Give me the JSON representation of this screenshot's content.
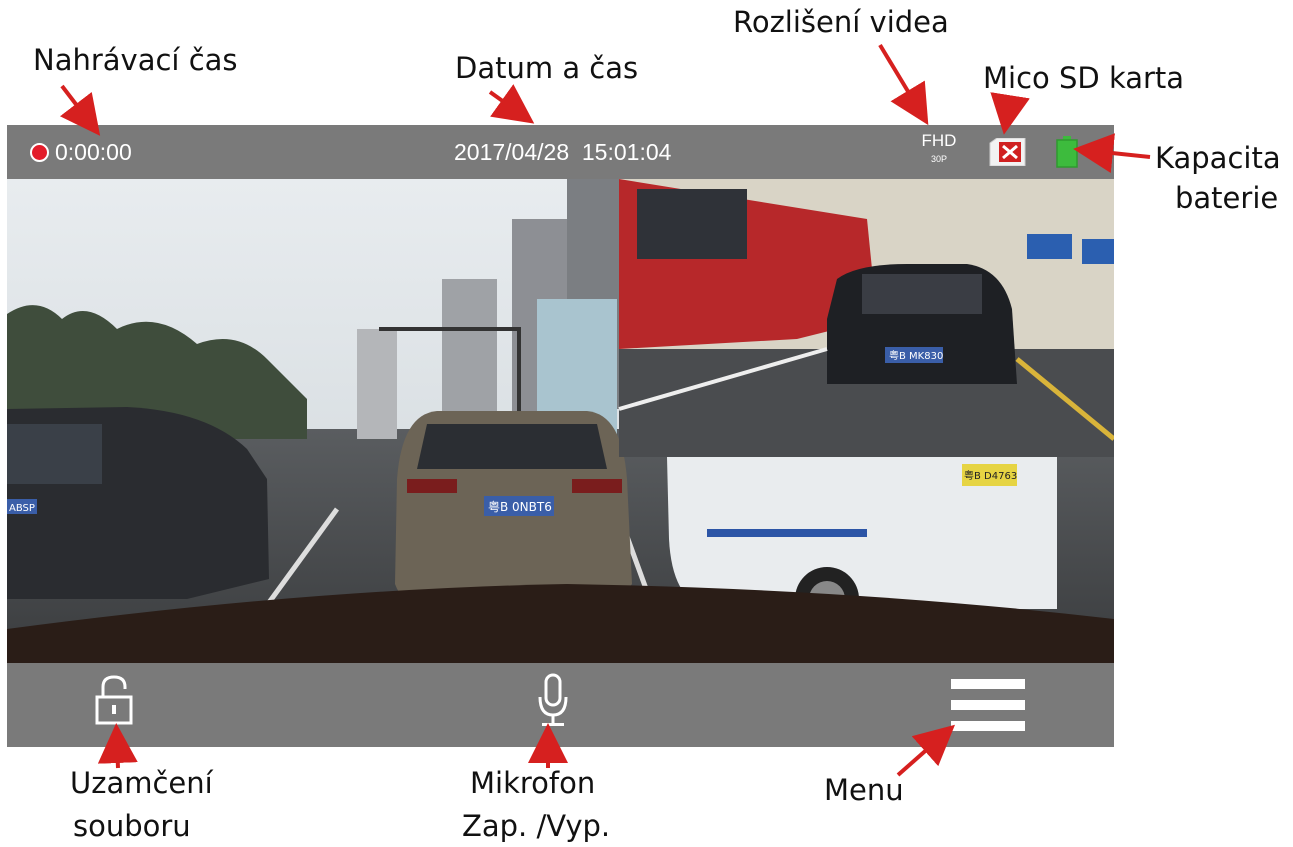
{
  "annotations": {
    "recording_time": "Nahrávací čas",
    "date_time": "Datum a čas",
    "video_resolution": "Rozlišení videa",
    "sd_card": "Mico SD karta",
    "battery_line1": "Kapacita",
    "battery_line2": "baterie",
    "lock_line1": "Uzamčení",
    "lock_line2": "souboru",
    "mic_line1": "Mikrofon",
    "mic_line2": "Zap. /Vyp.",
    "menu": "Menu"
  },
  "status_bar": {
    "recording_time": "0:00:00",
    "date_time": "2017/04/28  15:01:04",
    "resolution": "FHD",
    "frame_rate": "30P",
    "recording_icon": "record-dot-icon",
    "sd_icon": "sd-card-missing-icon",
    "battery_icon": "battery-full-icon"
  },
  "plates": {
    "front_car": "粤B 0NBT6",
    "left_car": "ABSP",
    "rear_suv": "粤B MK830",
    "white_car": "粤B D4763"
  },
  "colors": {
    "bar_gray": "#7a7a7a",
    "record_red": "#e31d2b",
    "arrow_red": "#d6201f",
    "battery_green": "#3dbb3d"
  },
  "bottom_bar": {
    "lock_icon": "unlock-icon",
    "mic_icon": "microphone-icon",
    "menu_icon": "hamburger-menu-icon"
  }
}
